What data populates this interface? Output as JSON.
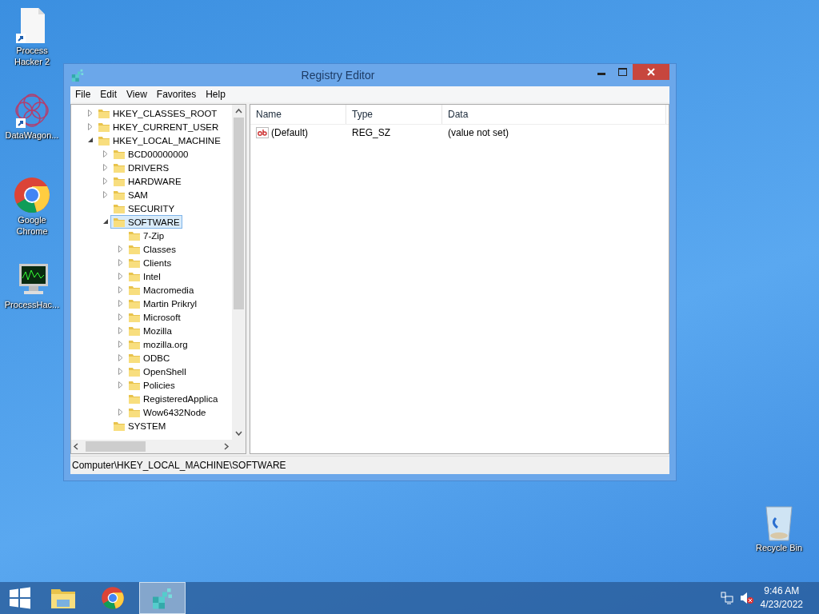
{
  "desktop_icons": [
    {
      "label": "Process\nHacker 2",
      "kind": "document"
    },
    {
      "label": "DataWagon...",
      "kind": "wagon"
    },
    {
      "label": "Google\nChrome",
      "kind": "chrome"
    },
    {
      "label": "ProcessHac...",
      "kind": "monitor"
    }
  ],
  "recycle_bin": {
    "label": "Recycle Bin"
  },
  "window": {
    "title": "Registry Editor",
    "menu": [
      "File",
      "Edit",
      "View",
      "Favorites",
      "Help"
    ],
    "tree": [
      {
        "label": "HKEY_CLASSES_ROOT",
        "expandable": true,
        "expanded": false,
        "selected": false
      },
      {
        "label": "HKEY_CURRENT_USER",
        "expandable": true,
        "expanded": false,
        "selected": false
      },
      {
        "label": "HKEY_LOCAL_MACHINE",
        "expandable": true,
        "expanded": true,
        "selected": false,
        "children": [
          {
            "label": "BCD00000000",
            "expandable": true,
            "expanded": false,
            "selected": false
          },
          {
            "label": "DRIVERS",
            "expandable": true,
            "expanded": false,
            "selected": false
          },
          {
            "label": "HARDWARE",
            "expandable": true,
            "expanded": false,
            "selected": false
          },
          {
            "label": "SAM",
            "expandable": true,
            "expanded": false,
            "selected": false
          },
          {
            "label": "SECURITY",
            "expandable": false,
            "expanded": false,
            "selected": false
          },
          {
            "label": "SOFTWARE",
            "expandable": true,
            "expanded": true,
            "selected": true,
            "children": [
              {
                "label": "7-Zip",
                "expandable": false,
                "expanded": false,
                "selected": false
              },
              {
                "label": "Classes",
                "expandable": true,
                "expanded": false,
                "selected": false
              },
              {
                "label": "Clients",
                "expandable": true,
                "expanded": false,
                "selected": false
              },
              {
                "label": "Intel",
                "expandable": true,
                "expanded": false,
                "selected": false
              },
              {
                "label": "Macromedia",
                "expandable": true,
                "expanded": false,
                "selected": false
              },
              {
                "label": "Martin Prikryl",
                "expandable": true,
                "expanded": false,
                "selected": false
              },
              {
                "label": "Microsoft",
                "expandable": true,
                "expanded": false,
                "selected": false
              },
              {
                "label": "Mozilla",
                "expandable": true,
                "expanded": false,
                "selected": false
              },
              {
                "label": "mozilla.org",
                "expandable": true,
                "expanded": false,
                "selected": false
              },
              {
                "label": "ODBC",
                "expandable": true,
                "expanded": false,
                "selected": false
              },
              {
                "label": "OpenShell",
                "expandable": true,
                "expanded": false,
                "selected": false
              },
              {
                "label": "Policies",
                "expandable": true,
                "expanded": false,
                "selected": false
              },
              {
                "label": "RegisteredApplica",
                "expandable": false,
                "expanded": false,
                "selected": false
              },
              {
                "label": "Wow6432Node",
                "expandable": true,
                "expanded": false,
                "selected": false
              }
            ]
          },
          {
            "label": "SYSTEM",
            "expandable": false,
            "expanded": false,
            "selected": false
          }
        ]
      }
    ],
    "columns": [
      "Name",
      "Type",
      "Data"
    ],
    "values": [
      {
        "name": "(Default)",
        "type": "REG_SZ",
        "data": "(value not set)"
      }
    ],
    "status_bar": "Computer\\HKEY_LOCAL_MACHINE\\SOFTWARE"
  },
  "taskbar": {
    "items": [
      {
        "kind": "explorer",
        "selected": false
      },
      {
        "kind": "chrome",
        "selected": false
      },
      {
        "kind": "regedit",
        "selected": true
      }
    ],
    "time": "9:46 AM",
    "date": "4/23/2022"
  }
}
